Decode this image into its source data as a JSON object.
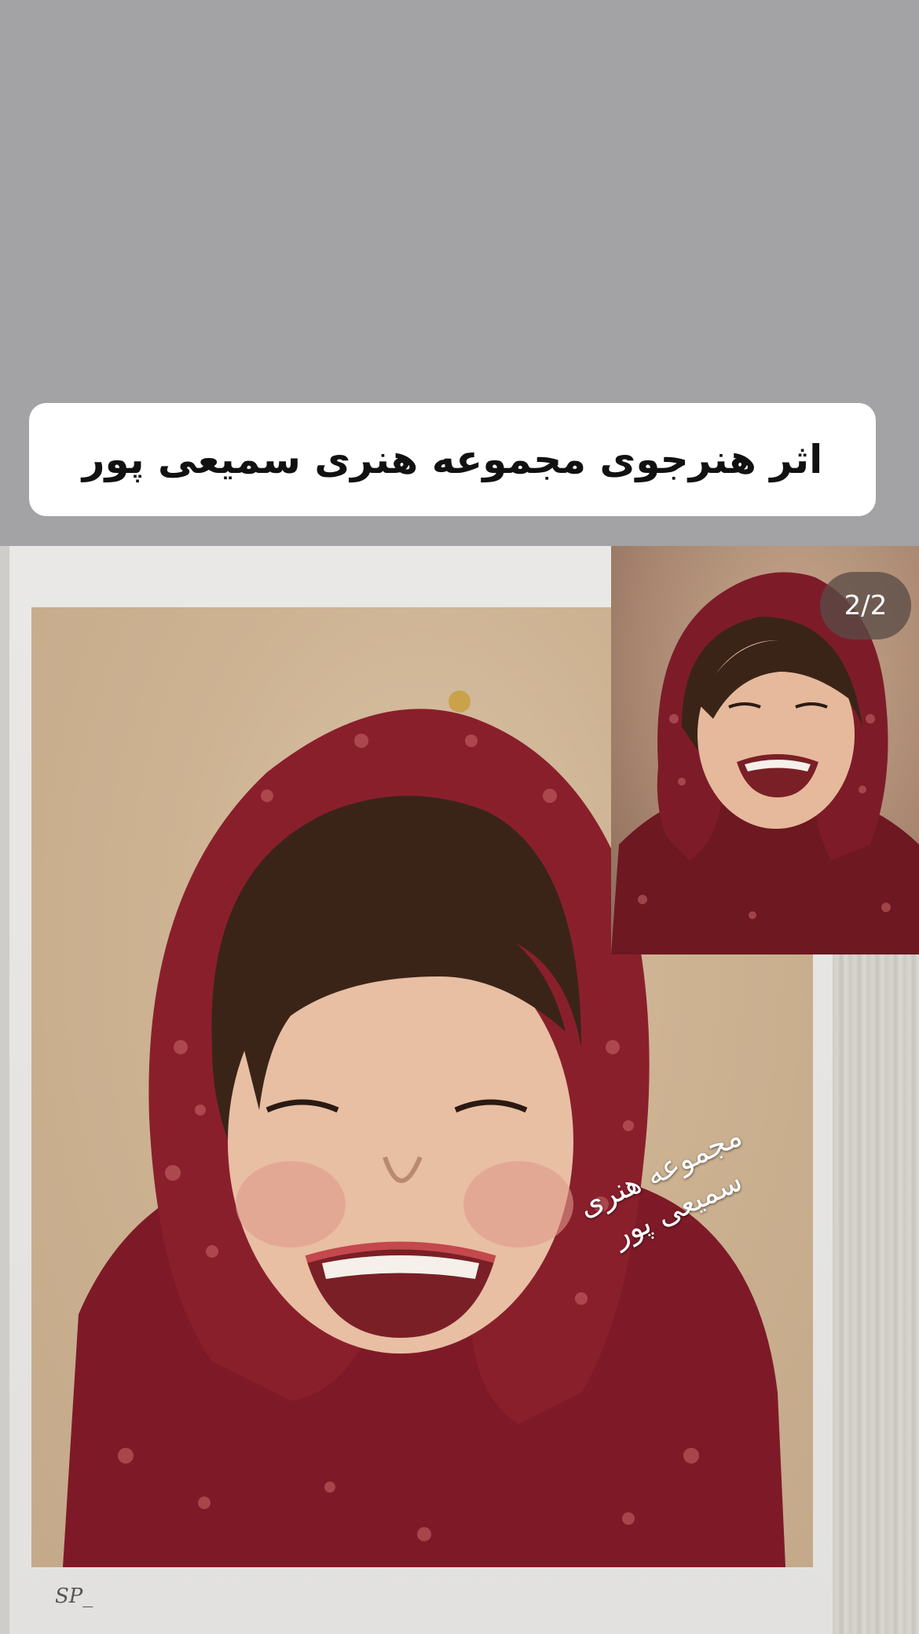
{
  "caption": {
    "text": "اثر هنرجوی مجموعه هنری سمیعی پور"
  },
  "media": {
    "page_indicator": "2/2",
    "watermark_line1": "مجموعه هنری",
    "watermark_line2": "سمیعی پور",
    "signature": "SP_"
  },
  "colors": {
    "background": "#a3a2a4",
    "caption_box": "#ffffff",
    "scarf_red": "#8a1f2c",
    "hair_brown": "#3a2418",
    "skin": "#e8bfa3"
  }
}
